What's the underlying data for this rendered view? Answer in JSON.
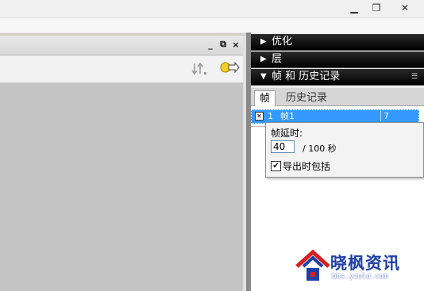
{
  "window": {
    "min_icon": "minimize-icon",
    "max_icon": "restore-icon",
    "close_icon": "close-icon"
  },
  "document": {
    "min_glyph": "_",
    "restore_glyph": "⧉",
    "close_glyph": "×",
    "tools": [
      "sort-icon",
      "export-icon"
    ]
  },
  "dock": {
    "panels": [
      {
        "label": "优化",
        "state": "collapsed",
        "arrow": "▶"
      },
      {
        "label": "层",
        "state": "collapsed",
        "arrow": "▶"
      },
      {
        "label": "帧 和 历史记录",
        "state": "expanded",
        "arrow": "▼"
      }
    ],
    "tabs": [
      "帧",
      "历史记录"
    ],
    "frame": {
      "number": "1",
      "name": "帧1",
      "delay": "7"
    }
  },
  "popup": {
    "title": "帧延时:",
    "value": "40",
    "unit": "/ 100 秒",
    "checkbox_label": "导出时包括",
    "checked": true
  },
  "watermark": {
    "brand": "晓枫资讯",
    "site": "bbs.yzwlo.com"
  },
  "colors": {
    "dock_bar": "#000000",
    "selection": "#3399ff",
    "brand": "#1f3fa8",
    "accent_red": "#d62020"
  }
}
